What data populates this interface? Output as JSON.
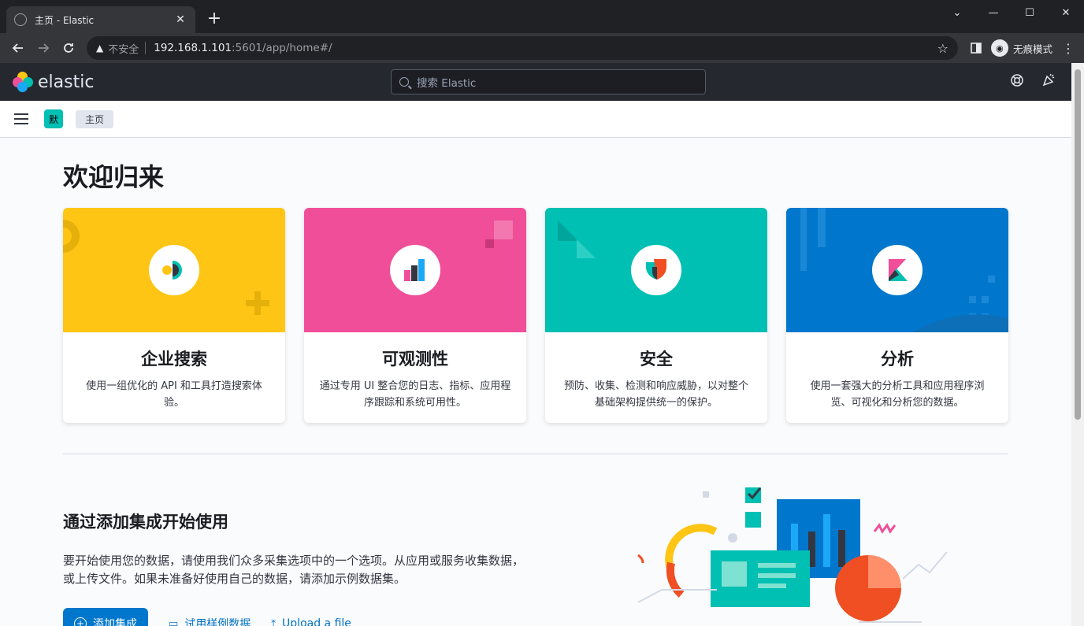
{
  "browser": {
    "tab_title": "主页 - Elastic",
    "close_glyph": "✕",
    "new_tab_glyph": "+",
    "window_controls": [
      "⌄",
      "—",
      "☐",
      "✕"
    ],
    "security_label": "不安全",
    "url_host": "192.168.1.101",
    "url_rest": ":5601/app/home#/",
    "incognito_label": "无痕模式"
  },
  "kibana": {
    "logo_text": "elastic",
    "search_placeholder": "搜索 Elastic",
    "space_initial": "默",
    "breadcrumb": "主页"
  },
  "main": {
    "welcome": "欢迎归来",
    "cards": [
      {
        "title": "企业搜索",
        "desc": "使用一组优化的 API 和工具打造搜索体验。",
        "color": "#fec514"
      },
      {
        "title": "可观测性",
        "desc": "通过专用 UI 整合您的日志、指标、应用程序跟踪和系统可用性。",
        "color": "#f04e98"
      },
      {
        "title": "安全",
        "desc": "预防、收集、检测和响应威胁，以对整个基础架构提供统一的保护。",
        "color": "#00bfb3"
      },
      {
        "title": "分析",
        "desc": "使用一套强大的分析工具和应用程序浏览、可视化和分析您的数据。",
        "color": "#0077cc"
      }
    ],
    "integrations": {
      "title": "通过添加集成开始使用",
      "desc": "要开始使用您的数据，请使用我们众多采集选项中的一个选项。从应用或服务收集数据，或上传文件。如果未准备好使用自己的数据，请添加示例数据集。",
      "add_button": "添加集成",
      "sample_link": "试用样例数据",
      "upload_link": "Upload a file"
    }
  }
}
